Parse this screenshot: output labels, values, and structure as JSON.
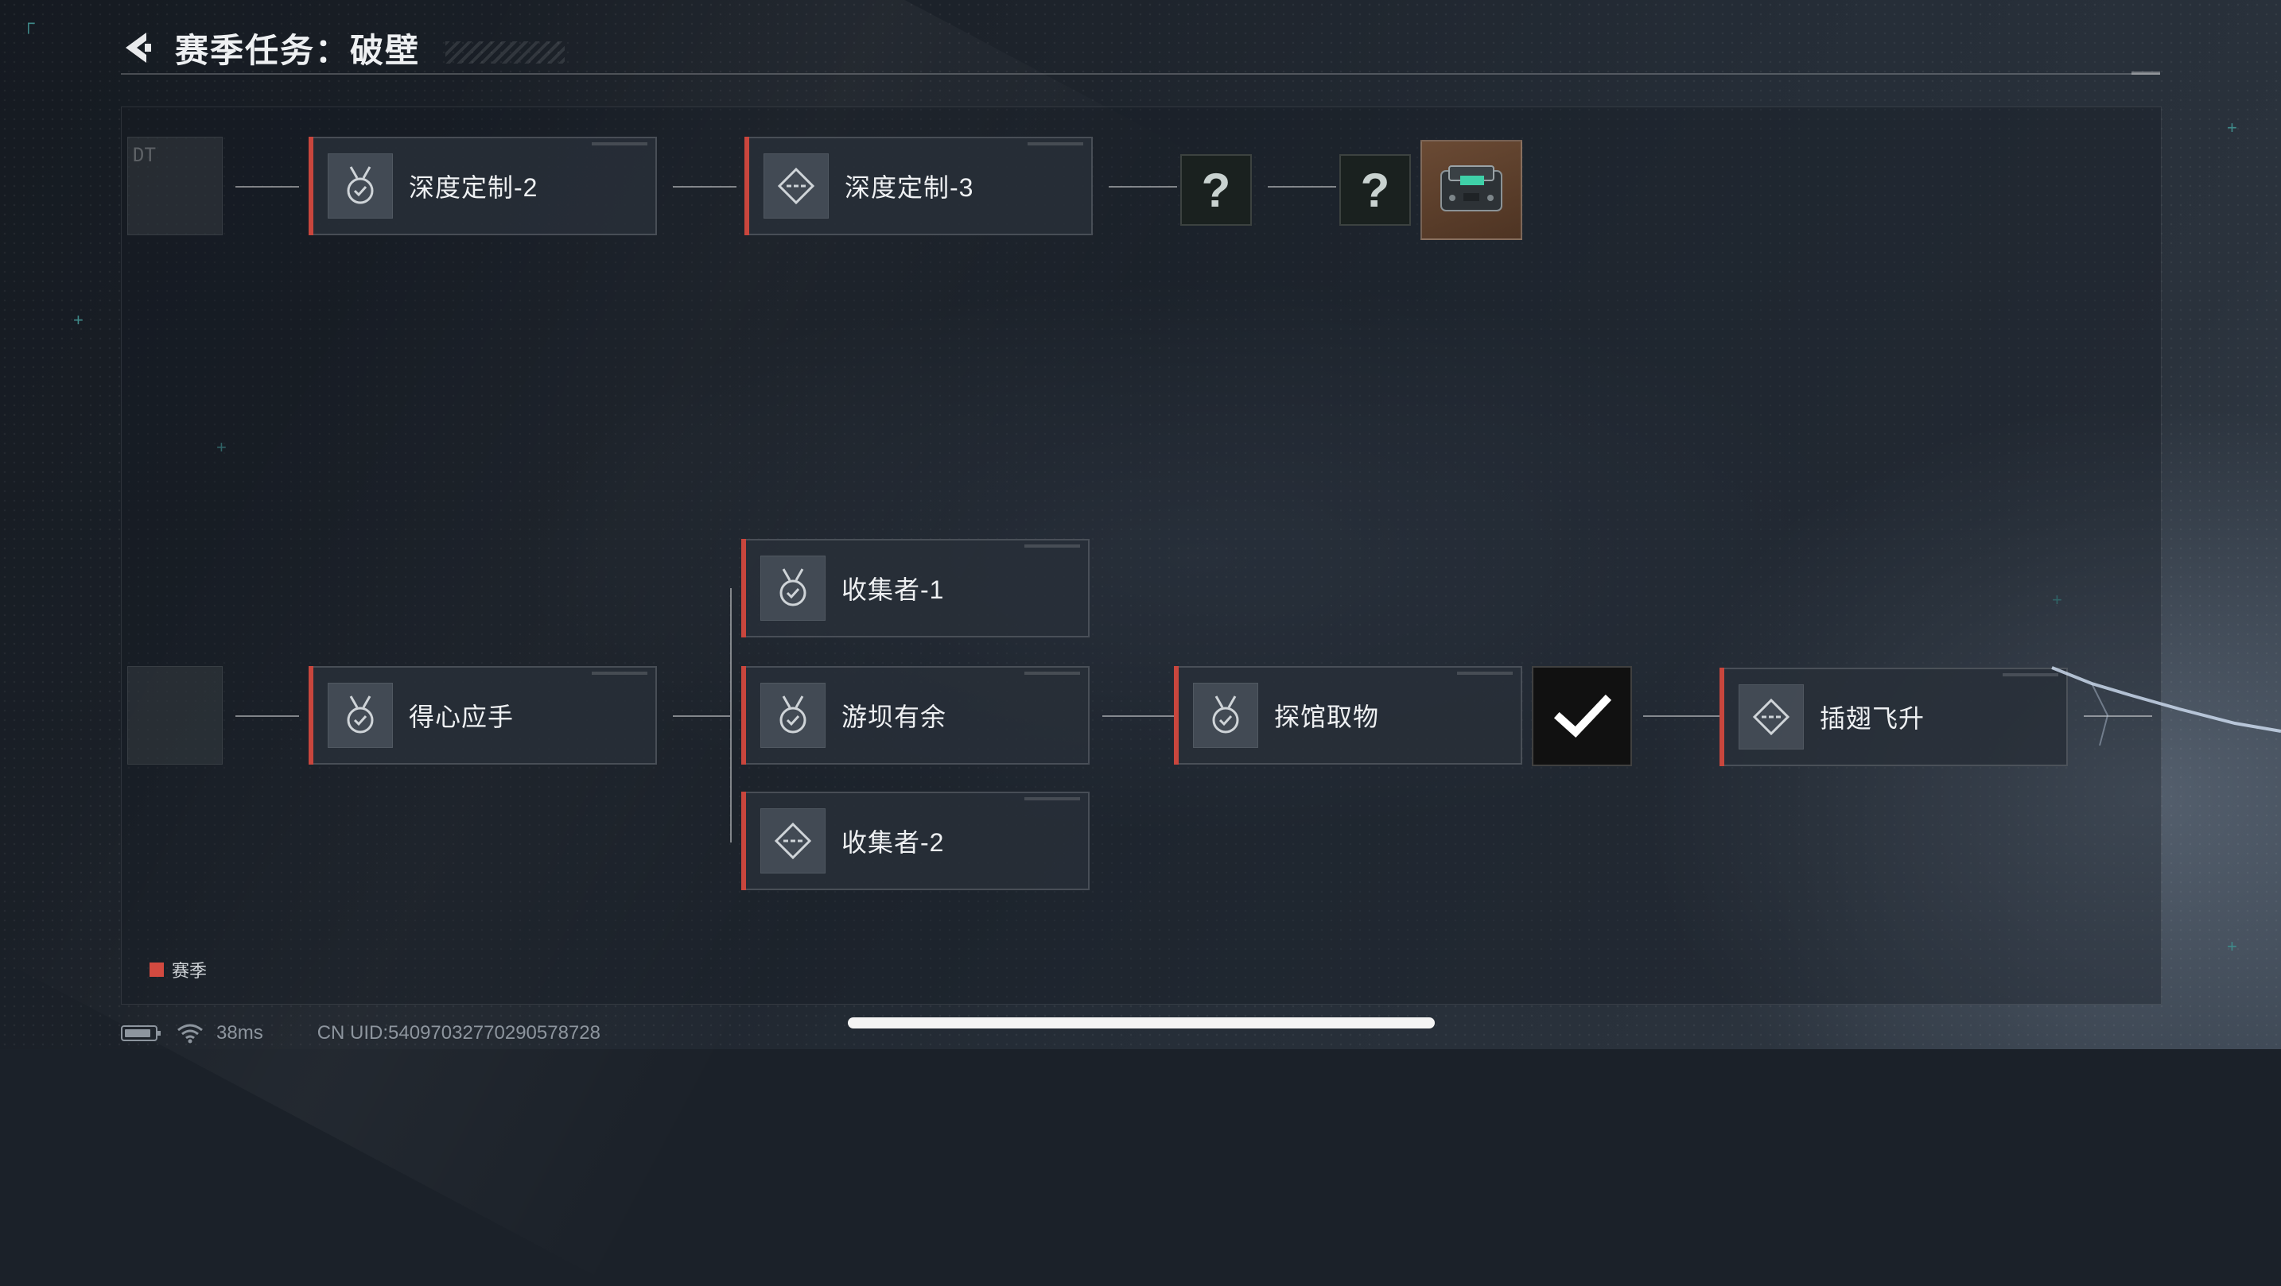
{
  "header": {
    "title": "赛季任务：破壁",
    "back_icon": "back-arrow-icon"
  },
  "ghost_nodes": {
    "top_text": "DT",
    "bottom_text": ""
  },
  "top_chain": {
    "nodes": [
      {
        "label": "深度定制-2",
        "icon": "medal-check-icon"
      },
      {
        "label": "深度定制-3",
        "icon": "diamond-dash-icon"
      }
    ],
    "unknown_1": "?",
    "unknown_2": "?",
    "reward_icon": "device-case-icon"
  },
  "bottom_chain": {
    "start": {
      "label": "得心应手",
      "icon": "medal-check-icon"
    },
    "branches": [
      {
        "label": "收集者-1",
        "icon": "medal-check-icon"
      },
      {
        "label": "游坝有余",
        "icon": "medal-check-icon"
      },
      {
        "label": "收集者-2",
        "icon": "diamond-dash-icon"
      }
    ],
    "merge": {
      "label": "探馆取物",
      "icon": "medal-check-icon"
    },
    "completed_icon": "checkmark-icon",
    "final": {
      "label": "插翅飞升",
      "icon": "diamond-dash-icon"
    }
  },
  "legend": {
    "label": "赛季",
    "color": "#d24a40"
  },
  "status_bar": {
    "ping": "38ms",
    "uid": "CN UID:54097032770290578728"
  },
  "colors": {
    "accent_red": "#c9463d",
    "background": "#1b2129"
  }
}
